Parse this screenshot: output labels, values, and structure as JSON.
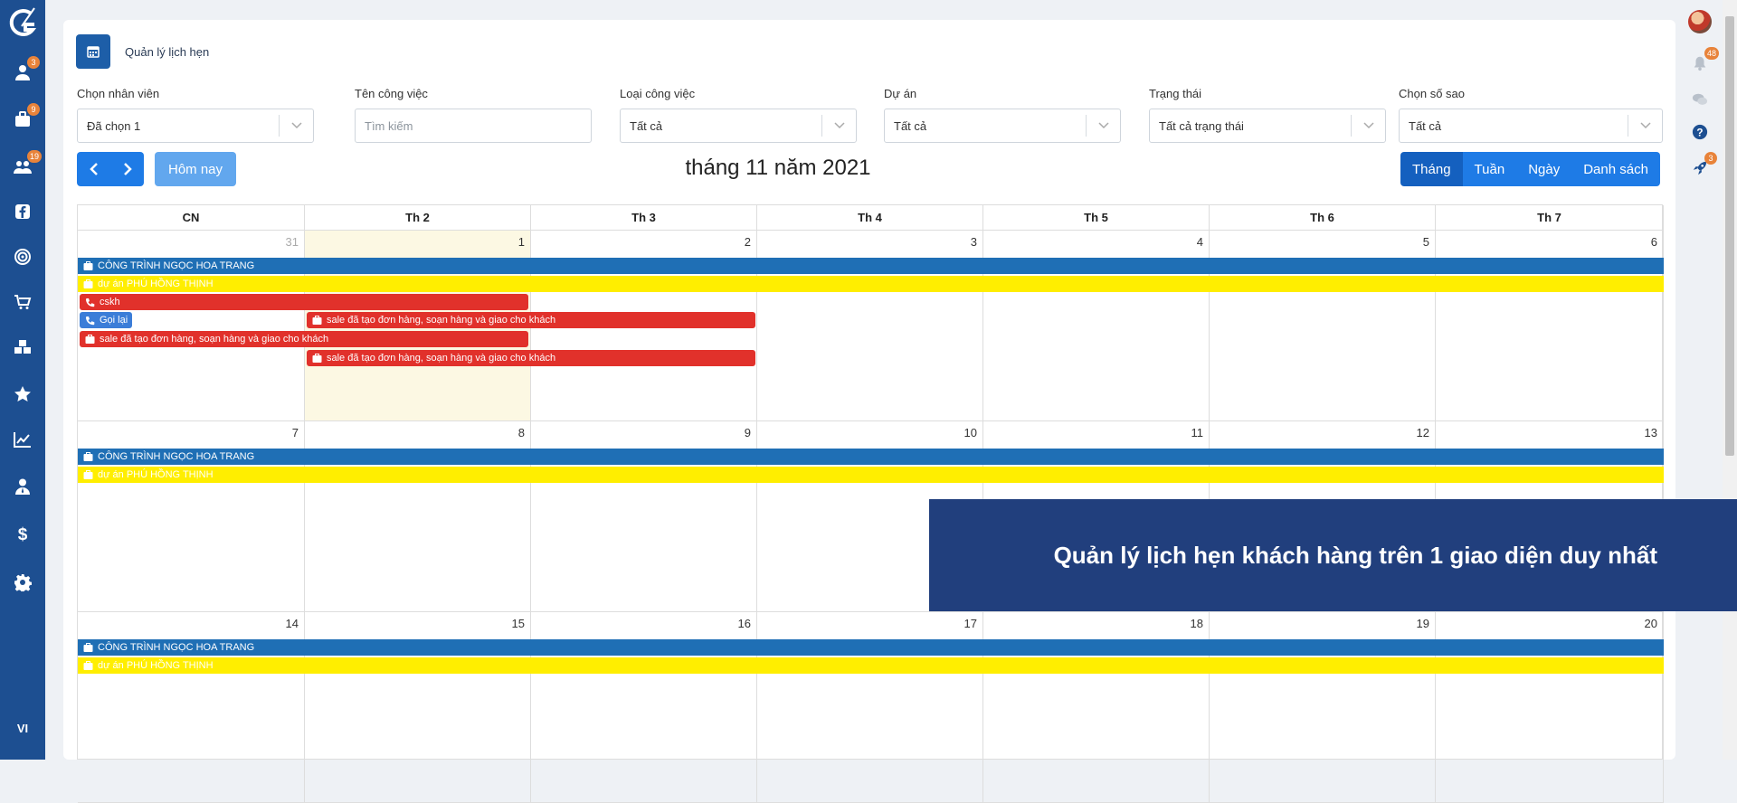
{
  "sidebar": {
    "badges": {
      "contacts": "3",
      "briefcase": "9",
      "users": "19"
    },
    "language": "VI"
  },
  "rail": {
    "notifications_badge": "48",
    "rocket_badge": "3"
  },
  "header": {
    "title": "Quản lý lịch hẹn"
  },
  "filters": {
    "employee": {
      "label": "Chọn nhân viên",
      "value": "Đã chọn 1"
    },
    "task_name": {
      "label": "Tên công việc",
      "placeholder": "Tìm kiếm"
    },
    "task_type": {
      "label": "Loại công việc",
      "value": "Tất cả"
    },
    "project": {
      "label": "Dự án",
      "value": "Tất cả"
    },
    "status": {
      "label": "Trạng thái",
      "value": "Tất cả trạng thái"
    },
    "stars": {
      "label": "Chọn số sao",
      "value": "Tất cả"
    }
  },
  "toolbar": {
    "today_label": "Hôm nay",
    "title": "tháng 11 năm 2021",
    "views": [
      "Tháng",
      "Tuần",
      "Ngày",
      "Danh sách"
    ]
  },
  "calendar": {
    "weekdays": [
      "CN",
      "Th 2",
      "Th 3",
      "Th 4",
      "Th 5",
      "Th 6",
      "Th 7"
    ],
    "weeks": [
      [
        "31",
        "1",
        "2",
        "3",
        "4",
        "5",
        "6"
      ],
      [
        "7",
        "8",
        "9",
        "10",
        "11",
        "12",
        "13"
      ],
      [
        "14",
        "15",
        "16",
        "17",
        "18",
        "19",
        "20"
      ]
    ],
    "events": {
      "project_blue": "CÔNG TRÌNH NGỌC HOA TRANG",
      "project_yellow": "dự án PHÚ HỒNG THỊNH",
      "cskh": "cskh",
      "call_back": "Gọi lại",
      "sale_order": "sale đã tạo đơn hàng, soạn hàng và giao cho khách"
    }
  },
  "promo": {
    "text": "Quản lý lịch hẹn khách hàng trên 1 giao diện duy nhất"
  },
  "colors": {
    "sidebar": "#1d4f91",
    "primary": "#1e7be6",
    "event_blue": "#1f6fb5",
    "event_yellow": "#ffee00",
    "event_red": "#e1312b",
    "promo": "#213f7d"
  }
}
